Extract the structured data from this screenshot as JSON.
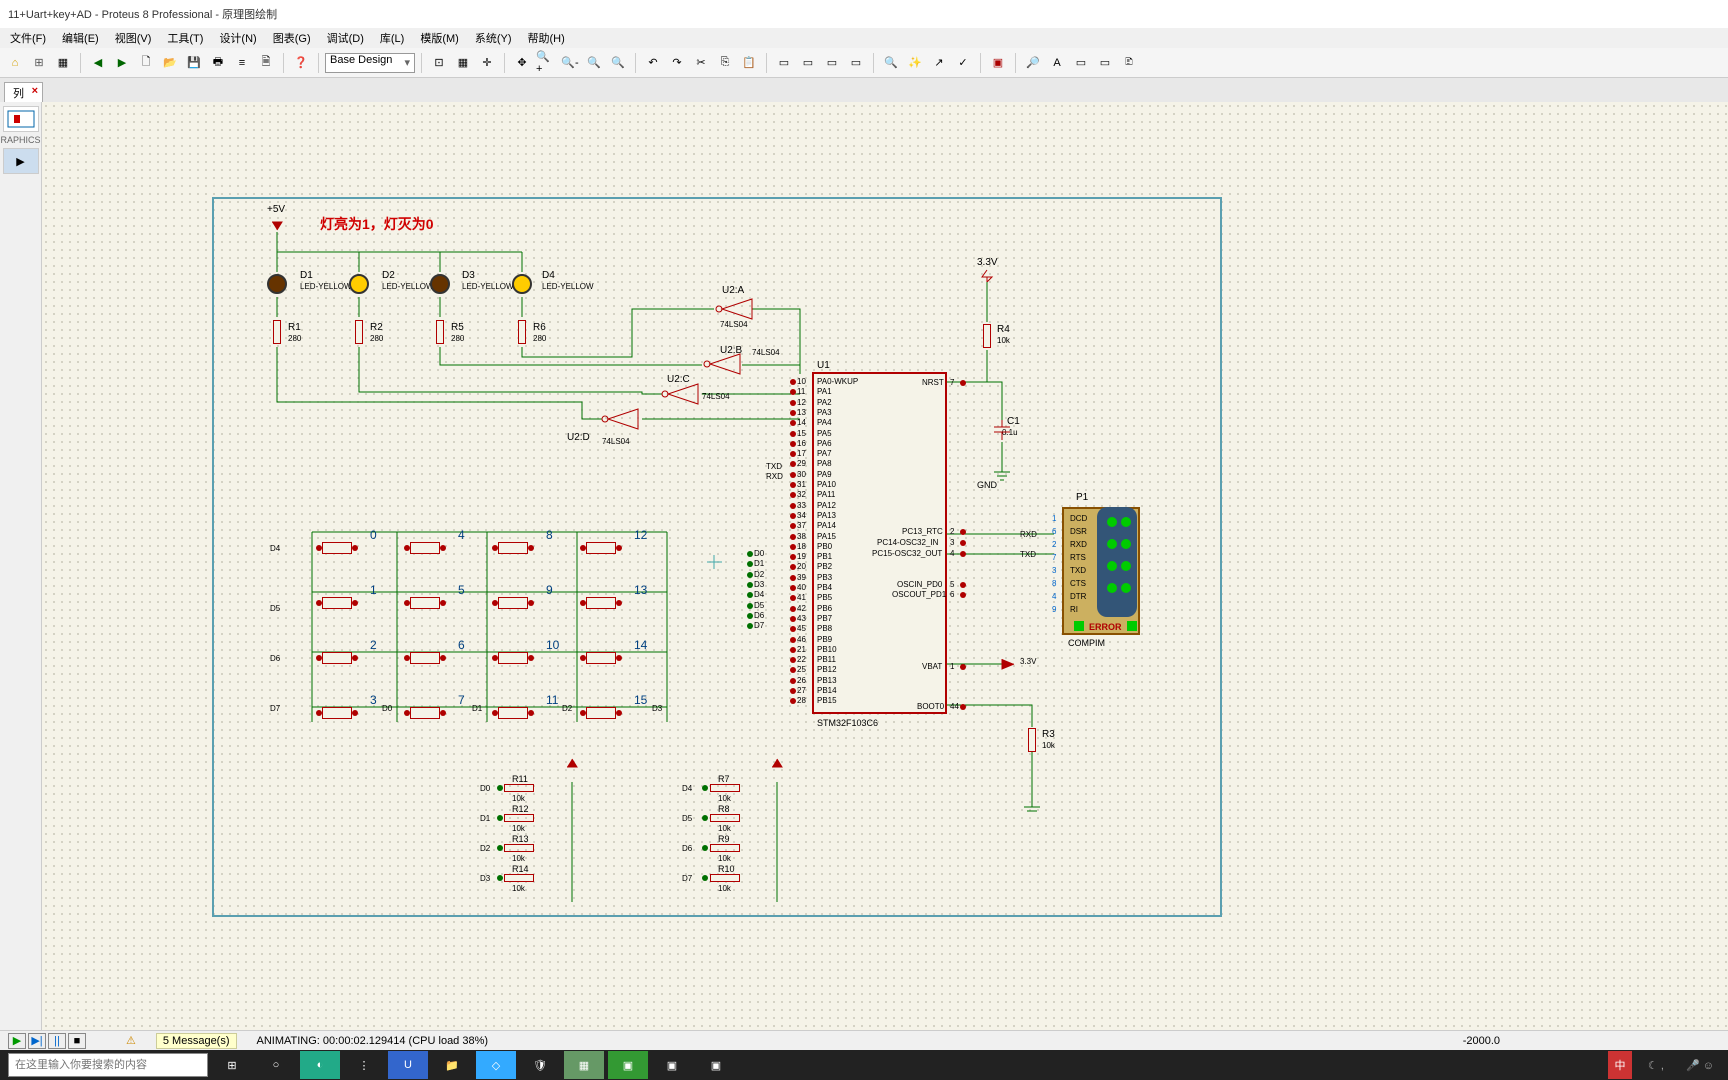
{
  "title": "11+Uart+key+AD - Proteus 8 Professional - 原理图绘制",
  "menu": [
    "文件(F)",
    "编辑(E)",
    "视图(V)",
    "工具(T)",
    "设计(N)",
    "图表(G)",
    "调试(D)",
    "库(L)",
    "模版(M)",
    "系统(Y)",
    "帮助(H)"
  ],
  "toolbar_combo": "Base Design",
  "tab": {
    "label": "列",
    "close": "×"
  },
  "side_label": "RAPHICS",
  "note": "灯亮为1，灯灭为0",
  "voltage5v": "+5V",
  "voltage33v": "3.3V",
  "leds": [
    {
      "ref": "D1",
      "type": "LED-YELLOW",
      "on": false
    },
    {
      "ref": "D2",
      "type": "LED-YELLOW",
      "on": true
    },
    {
      "ref": "D3",
      "type": "LED-YELLOW",
      "on": false
    },
    {
      "ref": "D4",
      "type": "LED-YELLOW",
      "on": true
    }
  ],
  "led_resistors": [
    {
      "ref": "R1",
      "val": "280"
    },
    {
      "ref": "R2",
      "val": "280"
    },
    {
      "ref": "R5",
      "val": "280"
    },
    {
      "ref": "R6",
      "val": "280"
    }
  ],
  "inverters": [
    {
      "ref": "U2:A",
      "type": "74LS04"
    },
    {
      "ref": "U2:B",
      "type": "74LS04"
    },
    {
      "ref": "U2:C",
      "type": "74LS04"
    },
    {
      "ref": "U2:D",
      "type": "74LS04"
    }
  ],
  "mcu": {
    "ref": "U1",
    "part": "STM32F103C6"
  },
  "mcu_left_pins": [
    {
      "n": "10",
      "name": "PA0-WKUP"
    },
    {
      "n": "11",
      "name": "PA1"
    },
    {
      "n": "12",
      "name": "PA2"
    },
    {
      "n": "13",
      "name": "PA3"
    },
    {
      "n": "14",
      "name": "PA4"
    },
    {
      "n": "15",
      "name": "PA5"
    },
    {
      "n": "16",
      "name": "PA6"
    },
    {
      "n": "17",
      "name": "PA7"
    },
    {
      "n": "29",
      "name": "PA8"
    },
    {
      "n": "30",
      "name": "PA9"
    },
    {
      "n": "31",
      "name": "PA10"
    },
    {
      "n": "32",
      "name": "PA11"
    },
    {
      "n": "33",
      "name": "PA12"
    },
    {
      "n": "34",
      "name": "PA13"
    },
    {
      "n": "37",
      "name": "PA14"
    },
    {
      "n": "38",
      "name": "PA15"
    },
    {
      "n": "18",
      "name": "PB0"
    },
    {
      "n": "19",
      "name": "PB1"
    },
    {
      "n": "20",
      "name": "PB2"
    },
    {
      "n": "39",
      "name": "PB3"
    },
    {
      "n": "40",
      "name": "PB4"
    },
    {
      "n": "41",
      "name": "PB5"
    },
    {
      "n": "42",
      "name": "PB6"
    },
    {
      "n": "43",
      "name": "PB7"
    },
    {
      "n": "45",
      "name": "PB8"
    },
    {
      "n": "46",
      "name": "PB9"
    },
    {
      "n": "21",
      "name": "PB10"
    },
    {
      "n": "22",
      "name": "PB11"
    },
    {
      "n": "25",
      "name": "PB12"
    },
    {
      "n": "26",
      "name": "PB13"
    },
    {
      "n": "27",
      "name": "PB14"
    },
    {
      "n": "28",
      "name": "PB15"
    }
  ],
  "mcu_right_pins": [
    {
      "n": "7",
      "name": "NRST"
    },
    {
      "n": "2",
      "name": "PC13_RTC"
    },
    {
      "n": "3",
      "name": "PC14-OSC32_IN"
    },
    {
      "n": "4",
      "name": "PC15-OSC32_OUT"
    },
    {
      "n": "5",
      "name": "OSCIN_PD0"
    },
    {
      "n": "6",
      "name": "OSCOUT_PD1"
    },
    {
      "n": "1",
      "name": "VBAT"
    },
    {
      "n": "44",
      "name": "BOOT0"
    }
  ],
  "net_labels_left": [
    "TXD",
    "RXD",
    "D0",
    "D1",
    "D2",
    "D3",
    "D4",
    "D5",
    "D6",
    "D7"
  ],
  "pullup": {
    "ref": "R4",
    "val": "10k"
  },
  "cap": {
    "ref": "C1",
    "val": "0.1u"
  },
  "gnd": "GND",
  "r3": {
    "ref": "R3",
    "val": "10k"
  },
  "comport": {
    "ref": "P1",
    "error": "ERROR",
    "part": "COMPIM",
    "pins": [
      {
        "n": "1",
        "name": "DCD"
      },
      {
        "n": "6",
        "name": "DSR"
      },
      {
        "n": "2",
        "name": "RXD"
      },
      {
        "n": "7",
        "name": "RTS"
      },
      {
        "n": "3",
        "name": "TXD"
      },
      {
        "n": "8",
        "name": "CTS"
      },
      {
        "n": "4",
        "name": "DTR"
      },
      {
        "n": "9",
        "name": "RI"
      }
    ]
  },
  "rxd": "RXD",
  "txd": "TXD",
  "keypad_rows": [
    "D4",
    "D5",
    "D6",
    "D7"
  ],
  "keypad_cols": [
    "D0",
    "D1",
    "D2",
    "D3"
  ],
  "keypad_nums": [
    "0",
    "4",
    "8",
    "12",
    "1",
    "5",
    "9",
    "13",
    "2",
    "6",
    "10",
    "14",
    "3",
    "7",
    "11",
    "15"
  ],
  "pulldowns_left": [
    {
      "ref": "R11",
      "val": "10k",
      "net": "D0"
    },
    {
      "ref": "R12",
      "val": "10k",
      "net": "D1"
    },
    {
      "ref": "R13",
      "val": "10k",
      "net": "D2"
    },
    {
      "ref": "R14",
      "val": "10k",
      "net": "D3"
    }
  ],
  "pulldowns_right": [
    {
      "ref": "R7",
      "val": "10k",
      "net": "D4"
    },
    {
      "ref": "R8",
      "val": "10k",
      "net": "D5"
    },
    {
      "ref": "R9",
      "val": "10k",
      "net": "D6"
    },
    {
      "ref": "R10",
      "val": "10k",
      "net": "D7"
    }
  ],
  "v33_right": "3.3V",
  "status": {
    "messages": "5 Message(s)",
    "anim": "ANIMATING: 00:00:02.129414 (CPU load 38%)",
    "coord": "-2000.0"
  },
  "search_placeholder": "在这里输入你要搜索的内容",
  "ime": "中"
}
